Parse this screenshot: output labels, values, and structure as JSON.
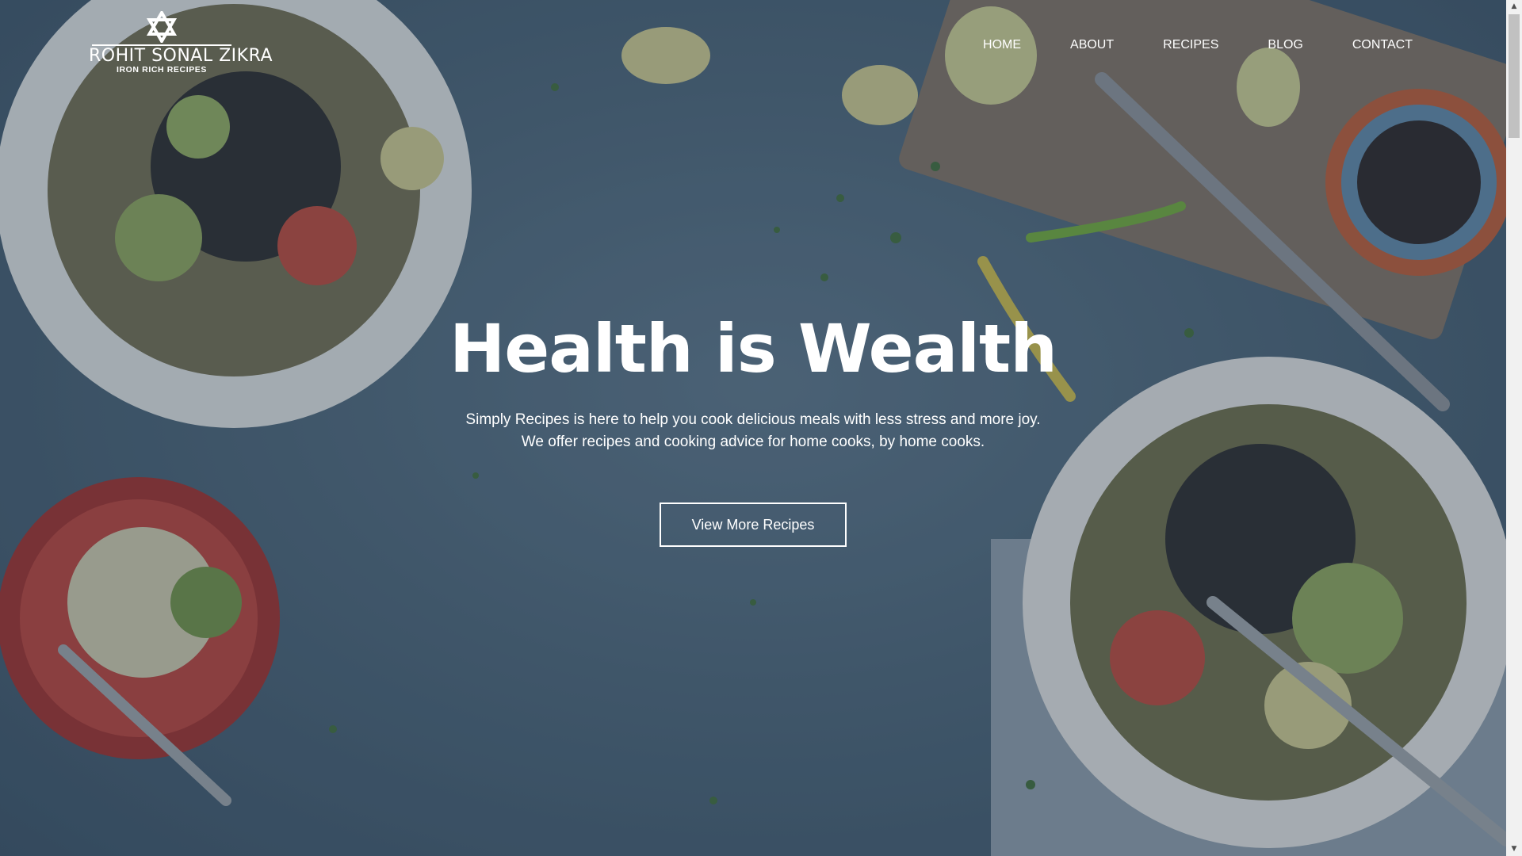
{
  "brand": {
    "name": "ROHIT SONAL ZIKRA",
    "tagline": "IRON RICH RECIPES"
  },
  "nav": {
    "items": [
      {
        "label": "HOME"
      },
      {
        "label": "ABOUT"
      },
      {
        "label": "RECIPES"
      },
      {
        "label": "BLOG"
      },
      {
        "label": "CONTACT"
      }
    ]
  },
  "hero": {
    "title": "Health is Wealth",
    "line1": "Simply Recipes is here to help you cook delicious meals with less stress and more joy.",
    "line2": "We offer recipes and cooking advice for home cooks, by home cooks.",
    "button_label": "View More Recipes"
  },
  "colors": {
    "background": "#4a6275",
    "text": "#ffffff",
    "plate": "#e8e8e6",
    "bowl_red": "#b5362e"
  },
  "icons": {
    "logo": "star-of-david-icon",
    "scroll_up": "arrow-up-icon",
    "scroll_down": "arrow-down-icon"
  }
}
